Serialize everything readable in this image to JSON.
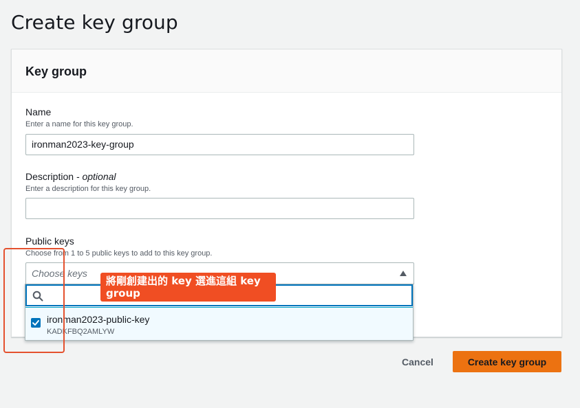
{
  "page": {
    "title": "Create key group"
  },
  "card": {
    "header": "Key group"
  },
  "name_field": {
    "label": "Name",
    "description": "Enter a name for this key group.",
    "value": "ironman2023-key-group"
  },
  "description_field": {
    "label": "Description",
    "label_suffix": " - optional",
    "description": "Enter a description for this key group.",
    "value": ""
  },
  "public_keys_field": {
    "label": "Public keys",
    "description": "Choose from 1 to 5 public keys to add to this key group.",
    "placeholder": "Choose keys",
    "filter_value": "",
    "options": [
      {
        "label": "ironman2023-public-key",
        "id": "KADKFBQ2AMLYW",
        "checked": true
      }
    ]
  },
  "annotation": {
    "text": "將剛創建出的 key 選進這組 key group"
  },
  "actions": {
    "cancel_label": "Cancel",
    "create_label": "Create key group"
  },
  "colors": {
    "primary_button": "#ec7211",
    "focus_blue": "#0073bb",
    "annotation_red": "#f04e23"
  },
  "icons": {
    "search": "search-icon",
    "caret": "caret-up-icon",
    "checkbox": "checkmark-icon"
  }
}
